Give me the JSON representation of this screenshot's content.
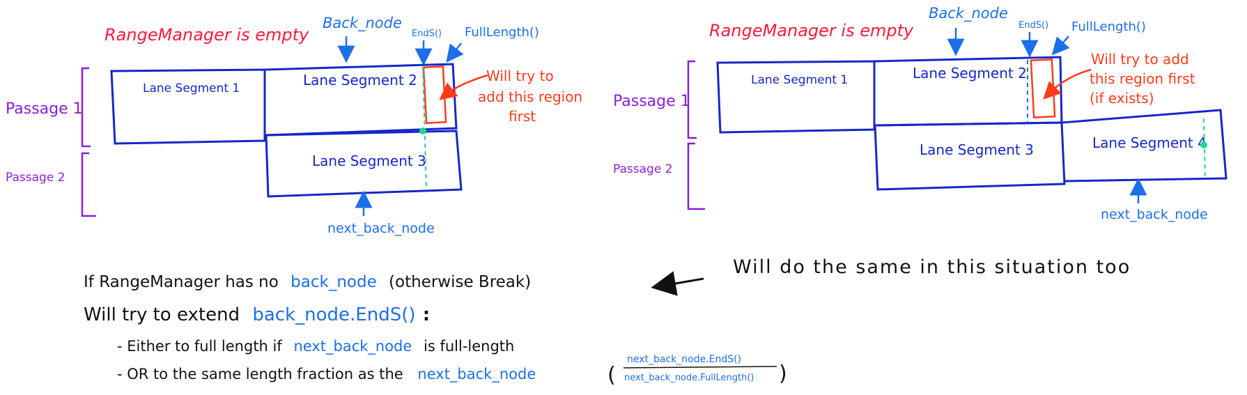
{
  "left": {
    "title": "RangeManager is empty",
    "back_node": "Back_node",
    "ends": "EndS()",
    "full_length": "FullLength()",
    "passage1": "Passage 1",
    "passage2": "Passage 2",
    "seg1": "Lane Segment 1",
    "seg2": "Lane Segment 2",
    "seg3": "Lane Segment 3",
    "note_line1": "Will try to",
    "note_line2": "add this region",
    "note_line3": "first",
    "next_back_node": "next_back_node"
  },
  "right": {
    "title": "RangeManager is empty",
    "back_node": "Back_node",
    "ends": "EndS()",
    "full_length": "FullLength()",
    "passage1": "Passage 1",
    "passage2": "Passage 2",
    "seg1": "Lane Segment 1",
    "seg2": "Lane Segment 2",
    "seg3": "Lane Segment 3",
    "seg4": "Lane Segment 4",
    "note_line1": "Will try to add",
    "note_line2": "this region first",
    "note_line3": "(if exists)",
    "next_back_node": "next_back_node"
  },
  "bottom": {
    "line1_a": "If RangeManager has no",
    "line1_b": "back_node",
    "line1_c": "(otherwise Break)",
    "line2_a": "Will try to extend",
    "line2_b": "back_node.EndS()",
    "line2_c": ":",
    "bullet1_a": "- Either to full length if",
    "bullet1_b": "next_back_node",
    "bullet1_c": "is full-length",
    "bullet2_a": "- OR to the same length fraction as the",
    "bullet2_b": "next_back_node",
    "frac_open": "(",
    "frac_num": "next_back_node.EndS()",
    "frac_den": "next_back_node.FullLength()",
    "frac_close": ")"
  },
  "side_note": "Will do the same in this situation too"
}
